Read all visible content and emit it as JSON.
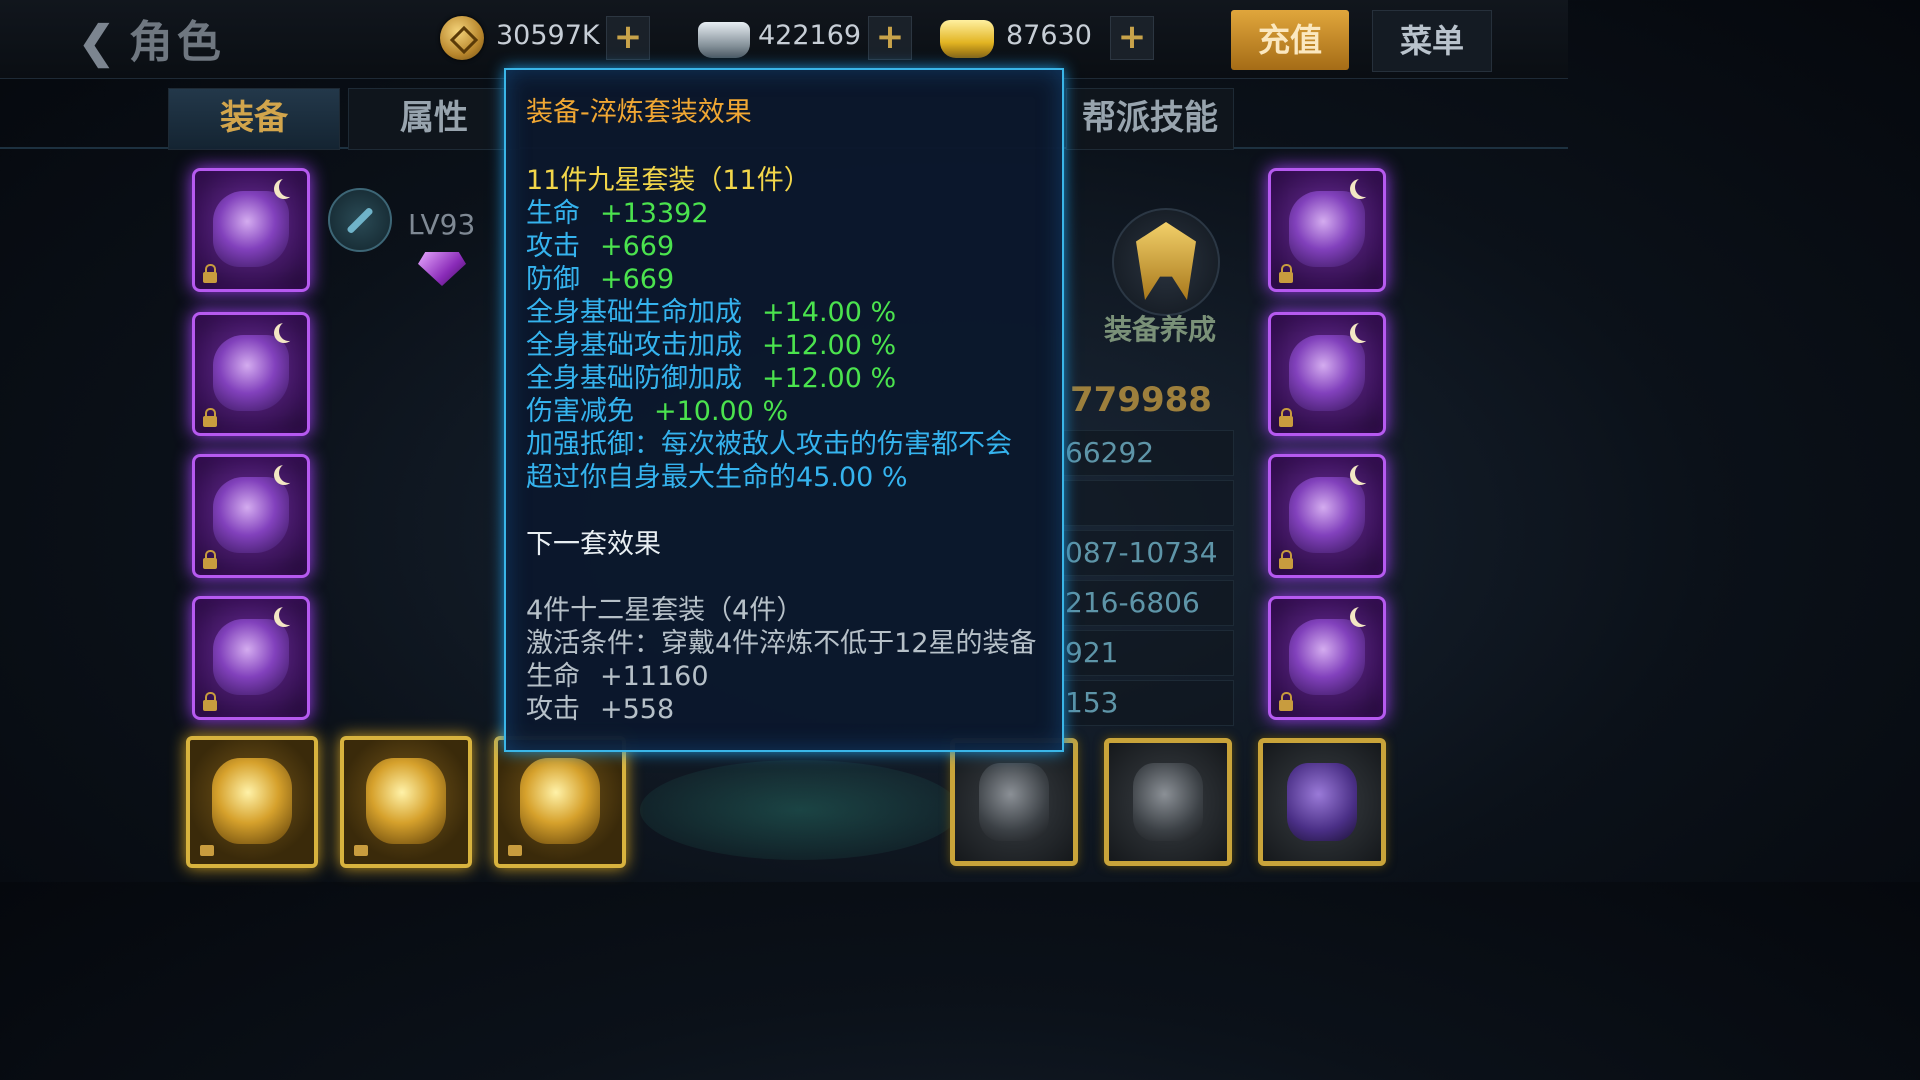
{
  "header": {
    "title": "角色",
    "currencies": [
      {
        "name": "coin",
        "value": "30597K"
      },
      {
        "name": "silver",
        "value": "422169"
      },
      {
        "name": "gold",
        "value": "87630"
      }
    ],
    "plus_label": "+",
    "recharge_label": "充值",
    "menu_label": "菜单"
  },
  "tabs": {
    "equipment": "装备",
    "attributes": "属性",
    "guild_skills": "帮派技能"
  },
  "character": {
    "level": "LV93",
    "cultivate_label": "装备养成",
    "power": "779988",
    "stats": [
      "66292",
      "",
      "087-10734",
      "216-6806",
      "921",
      "153"
    ]
  },
  "tooltip": {
    "title": "装备-淬炼套装效果",
    "current_set": {
      "header": "11件九星套装（11件）",
      "lines": [
        {
          "label": "生命",
          "value": "+13392"
        },
        {
          "label": "攻击",
          "value": "+669"
        },
        {
          "label": "防御",
          "value": "+669"
        },
        {
          "label": "全身基础生命加成",
          "value": "+14.00 %"
        },
        {
          "label": "全身基础攻击加成",
          "value": "+12.00 %"
        },
        {
          "label": "全身基础防御加成",
          "value": "+12.00 %"
        },
        {
          "label": "伤害减免",
          "value": "+10.00 %"
        }
      ],
      "special_1": "加强抵御：每次被敌人攻击的伤害都不会",
      "special_2": "超过你自身最大生命的45.00 %"
    },
    "next_title": "下一套效果",
    "next_set": {
      "header": "4件十二星套装（4件）",
      "condition": "激活条件：穿戴4件淬炼不低于12星的装备",
      "lines": [
        {
          "label": "生命",
          "value": "+11160"
        },
        {
          "label": "攻击",
          "value": "+558"
        }
      ]
    }
  },
  "colors": {
    "title_orange": "#f0a733",
    "set_yellow": "#f2d64a",
    "stat_blue": "#35b3ee",
    "value_green": "#4be34e",
    "border_cyan": "#3ab6e8"
  }
}
